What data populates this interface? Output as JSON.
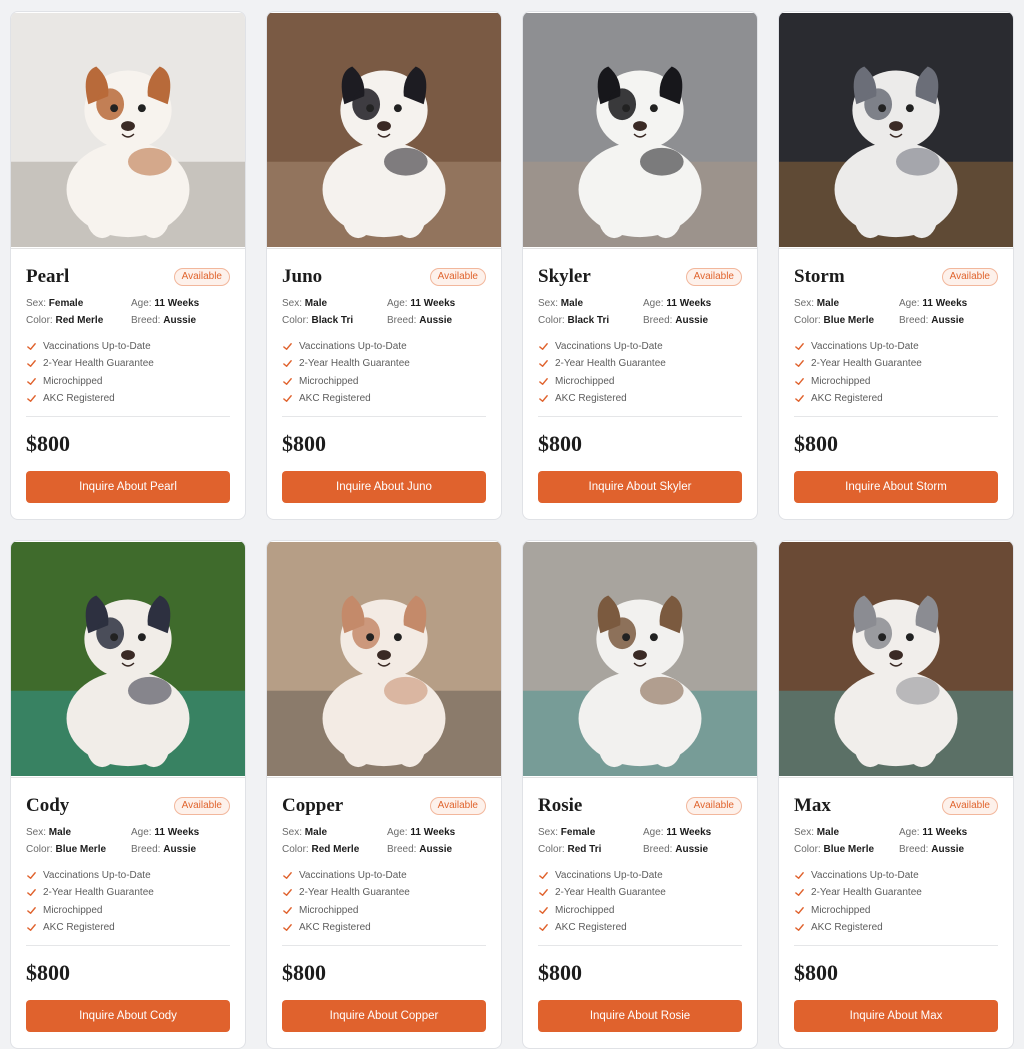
{
  "labels": {
    "sex": "Sex:",
    "age": "Age:",
    "color": "Color:",
    "breed": "Breed:"
  },
  "puppies": [
    {
      "name": "Pearl",
      "status": "Available",
      "sex": "Female",
      "age": "11 Weeks",
      "color": "Red Merle",
      "breed": "Aussie",
      "features": [
        "Vaccinations Up-to-Date",
        "2-Year Health Guarantee",
        "Microchipped",
        "AKC Registered"
      ],
      "price": "$800",
      "button": "Inquire About Pearl",
      "photo": {
        "bg": "#e9e7e4",
        "coat": "#f7f3ee",
        "patch": "#b86a3a",
        "accent": "#8a8076"
      }
    },
    {
      "name": "Juno",
      "status": "Available",
      "sex": "Male",
      "age": "11 Weeks",
      "color": "Black Tri",
      "breed": "Aussie",
      "features": [
        "Vaccinations Up-to-Date",
        "2-Year Health Guarantee",
        "Microchipped",
        "AKC Registered"
      ],
      "price": "$800",
      "button": "Inquire About Juno",
      "photo": {
        "bg": "#7a5a44",
        "coat": "#f5f2ee",
        "patch": "#1d1c22",
        "accent": "#c0a58c"
      }
    },
    {
      "name": "Skyler",
      "status": "Available",
      "sex": "Male",
      "age": "11 Weeks",
      "color": "Black Tri",
      "breed": "Aussie",
      "features": [
        "Vaccinations Up-to-Date",
        "2-Year Health Guarantee",
        "Microchipped",
        "AKC Registered"
      ],
      "price": "$800",
      "button": "Inquire About Skyler",
      "photo": {
        "bg": "#8e8f92",
        "coat": "#f4f4f2",
        "patch": "#17171b",
        "accent": "#b79b80"
      }
    },
    {
      "name": "Storm",
      "status": "Available",
      "sex": "Male",
      "age": "11 Weeks",
      "color": "Blue Merle",
      "breed": "Aussie",
      "features": [
        "Vaccinations Up-to-Date",
        "2-Year Health Guarantee",
        "Microchipped",
        "AKC Registered"
      ],
      "price": "$800",
      "button": "Inquire About Storm",
      "photo": {
        "bg": "#2a2b30",
        "coat": "#ecebea",
        "patch": "#6b6e78",
        "accent": "#c4843e"
      }
    },
    {
      "name": "Cody",
      "status": "Available",
      "sex": "Male",
      "age": "11 Weeks",
      "color": "Blue Merle",
      "breed": "Aussie",
      "features": [
        "Vaccinations Up-to-Date",
        "2-Year Health Guarantee",
        "Microchipped",
        "AKC Registered"
      ],
      "price": "$800",
      "button": "Inquire About Cody",
      "photo": {
        "bg": "#3f6b2c",
        "coat": "#f1ede8",
        "patch": "#2d3040",
        "accent": "#2bb0c9"
      }
    },
    {
      "name": "Copper",
      "status": "Available",
      "sex": "Male",
      "age": "11 Weeks",
      "color": "Red Merle",
      "breed": "Aussie",
      "features": [
        "Vaccinations Up-to-Date",
        "2-Year Health Guarantee",
        "Microchipped",
        "AKC Registered"
      ],
      "price": "$800",
      "button": "Inquire About Copper",
      "photo": {
        "bg": "#b69e86",
        "coat": "#f3ebe4",
        "patch": "#c48a6a",
        "accent": "#3c3a38"
      }
    },
    {
      "name": "Rosie",
      "status": "Available",
      "sex": "Female",
      "age": "11 Weeks",
      "color": "Red Tri",
      "breed": "Aussie",
      "features": [
        "Vaccinations Up-to-Date",
        "2-Year Health Guarantee",
        "Microchipped",
        "AKC Registered"
      ],
      "price": "$800",
      "button": "Inquire About Rosie",
      "photo": {
        "bg": "#a8a49e",
        "coat": "#f2f1ef",
        "patch": "#7b5a3f",
        "accent": "#1e8f8a"
      }
    },
    {
      "name": "Max",
      "status": "Available",
      "sex": "Male",
      "age": "11 Weeks",
      "color": "Blue Merle",
      "breed": "Aussie",
      "features": [
        "Vaccinations Up-to-Date",
        "2-Year Health Guarantee",
        "Microchipped",
        "AKC Registered"
      ],
      "price": "$800",
      "button": "Inquire About Max",
      "photo": {
        "bg": "#6a4a35",
        "coat": "#f1eeeb",
        "patch": "#8b8c92",
        "accent": "#3fb8c2"
      }
    }
  ],
  "colors": {
    "accent": "#e0622d",
    "badge_text": "#e0642e",
    "text_dark": "#1c1c1c"
  },
  "icons": {
    "check": "check-icon"
  }
}
